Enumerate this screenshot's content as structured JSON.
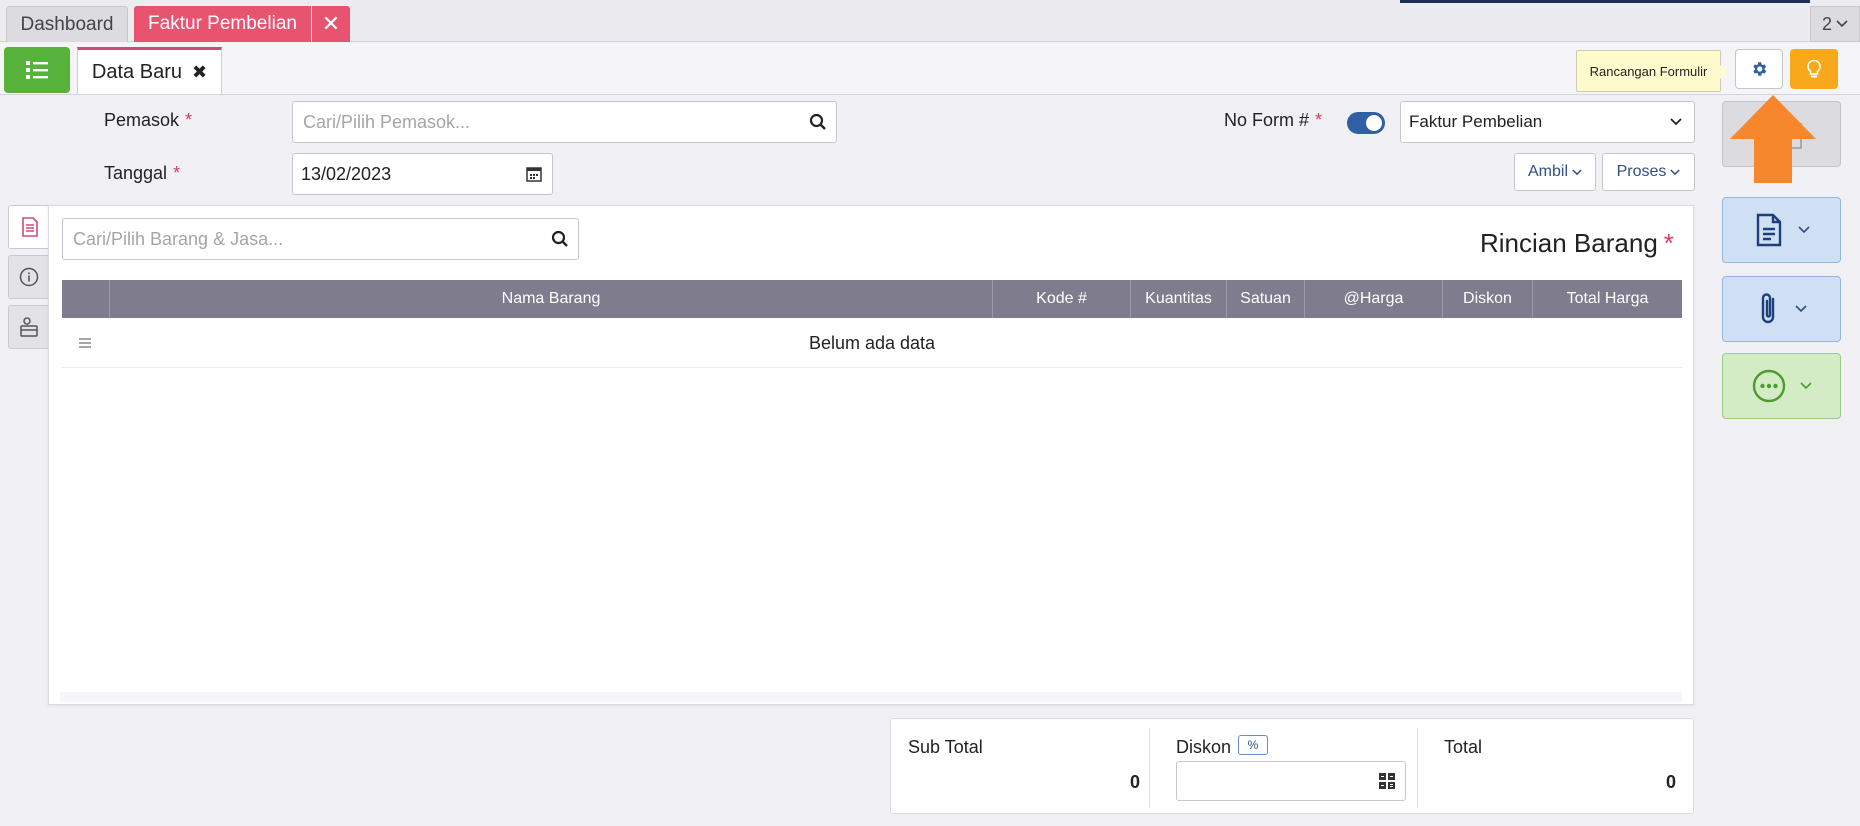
{
  "top_tabs": {
    "dashboard": "Dashboard",
    "active": "Faktur Pembelian",
    "count": "2"
  },
  "doc_tab": {
    "label": "Data Baru"
  },
  "tooltip": "Rancangan Formulir",
  "form": {
    "pemasok_label": "Pemasok",
    "pemasok_placeholder": "Cari/Pilih Pemasok...",
    "tanggal_label": "Tanggal",
    "tanggal_value": "13/02/2023",
    "noform_label": "No Form #",
    "noform_toggle_on": true,
    "form_type_selected": "Faktur Pembelian",
    "ambil_label": "Ambil",
    "proses_label": "Proses",
    "required_mark": "*"
  },
  "items": {
    "search_placeholder": "Cari/Pilih Barang & Jasa...",
    "section_title": "Rincian Barang",
    "columns": [
      "Nama Barang",
      "Kode #",
      "Kuantitas",
      "Satuan",
      "@Harga",
      "Diskon",
      "Total Harga"
    ],
    "empty_text": "Belum ada data"
  },
  "totals": {
    "subtotal_label": "Sub Total",
    "subtotal_value": "0",
    "diskon_label": "Diskon",
    "diskon_badge": "%",
    "total_label": "Total",
    "total_value": "0"
  },
  "colors": {
    "accent_pink": "#e8546f",
    "green": "#56b23a",
    "orange": "#f7a81b",
    "blue": "#2f5fa6",
    "table_header": "#7f7c8e"
  }
}
